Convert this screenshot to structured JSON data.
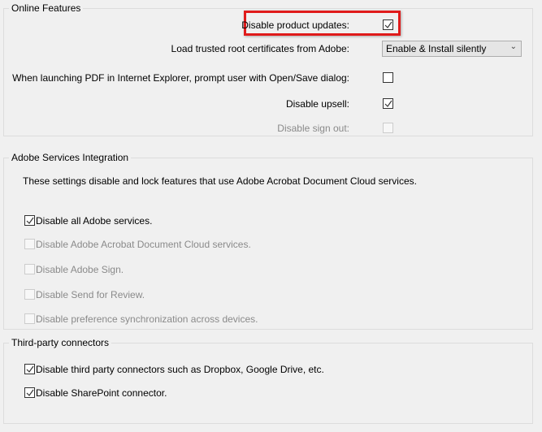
{
  "online_features": {
    "title": "Online Features",
    "disable_product_updates": {
      "label": "Disable product updates:",
      "checked": true
    },
    "load_certs": {
      "label": "Load trusted root certificates from Adobe:",
      "value": "Enable & Install silently"
    },
    "ie_prompt": {
      "label": "When launching PDF in Internet Explorer, prompt user with Open/Save dialog:",
      "checked": false
    },
    "disable_upsell": {
      "label": "Disable upsell:",
      "checked": true
    },
    "disable_sign_out": {
      "label": "Disable sign out:",
      "checked": false,
      "disabled": true
    }
  },
  "adobe_services": {
    "title": "Adobe Services Integration",
    "description": "These settings disable and lock features that use Adobe Acrobat Document Cloud services.",
    "items": [
      {
        "label": "Disable all Adobe services.",
        "checked": true,
        "disabled": false
      },
      {
        "label": "Disable Adobe Acrobat Document Cloud services.",
        "checked": false,
        "disabled": true
      },
      {
        "label": "Disable Adobe Sign.",
        "checked": false,
        "disabled": true
      },
      {
        "label": "Disable Send for Review.",
        "checked": false,
        "disabled": true
      },
      {
        "label": "Disable preference synchronization across devices.",
        "checked": false,
        "disabled": true
      }
    ]
  },
  "third_party": {
    "title": "Third-party connectors",
    "items": [
      {
        "label": "Disable third party connectors such as Dropbox, Google Drive, etc.",
        "checked": true
      },
      {
        "label": "Disable SharePoint connector.",
        "checked": true
      }
    ]
  },
  "colors": {
    "highlight": "#e01b1b"
  }
}
